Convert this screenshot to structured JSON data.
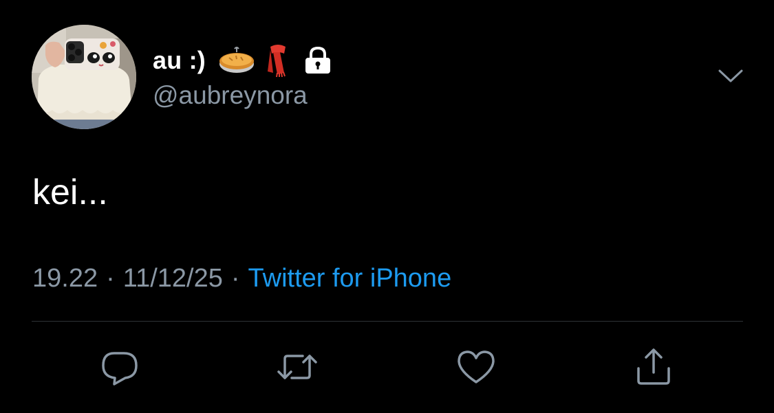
{
  "tweet": {
    "author": {
      "display_name": "au :)",
      "handle": "@aubreynora",
      "name_emojis": [
        "pie-icon",
        "scarf-icon",
        "lock-icon"
      ]
    },
    "text": "kei...",
    "meta": {
      "time": "19.22",
      "separator": "·",
      "date": "11/12/25",
      "source": "Twitter for iPhone"
    },
    "actions": [
      "reply-icon",
      "retweet-icon",
      "like-icon",
      "share-icon"
    ]
  },
  "colors": {
    "background": "#000000",
    "text_primary": "#ffffff",
    "text_secondary": "#8b98a5",
    "accent": "#1d9bf0",
    "divider": "#2f3336"
  }
}
